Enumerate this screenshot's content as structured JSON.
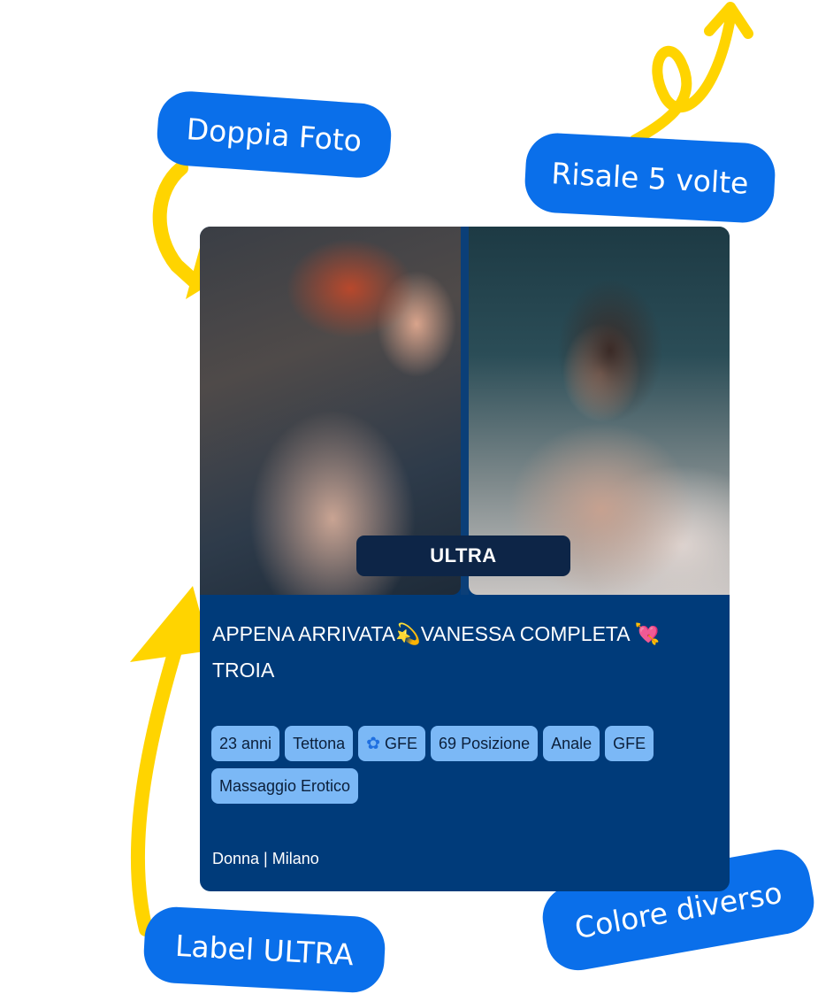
{
  "card": {
    "badge": "ULTRA",
    "title": "APPENA ARRIVATA💫VANESSA COMPLETA 💘 TROIA",
    "tags": [
      "23 anni",
      "Tettona",
      "GFE",
      "69 Posizione",
      "Anale",
      "GFE",
      "Massaggio Erotico"
    ],
    "tag_icons": [
      "",
      "",
      "flower-icon",
      "",
      "",
      "",
      ""
    ],
    "footer": "Donna | Milano",
    "background_color": "#003b7a",
    "tag_color": "#7bb8f6"
  },
  "annotations": {
    "doppia_foto": "Doppia Foto",
    "risale": "Risale 5 volte",
    "label_ultra": "Label ULTRA",
    "colore_diverso": "Colore diverso",
    "bubble_color": "#0a6fea",
    "arrow_color": "#ffd400"
  }
}
